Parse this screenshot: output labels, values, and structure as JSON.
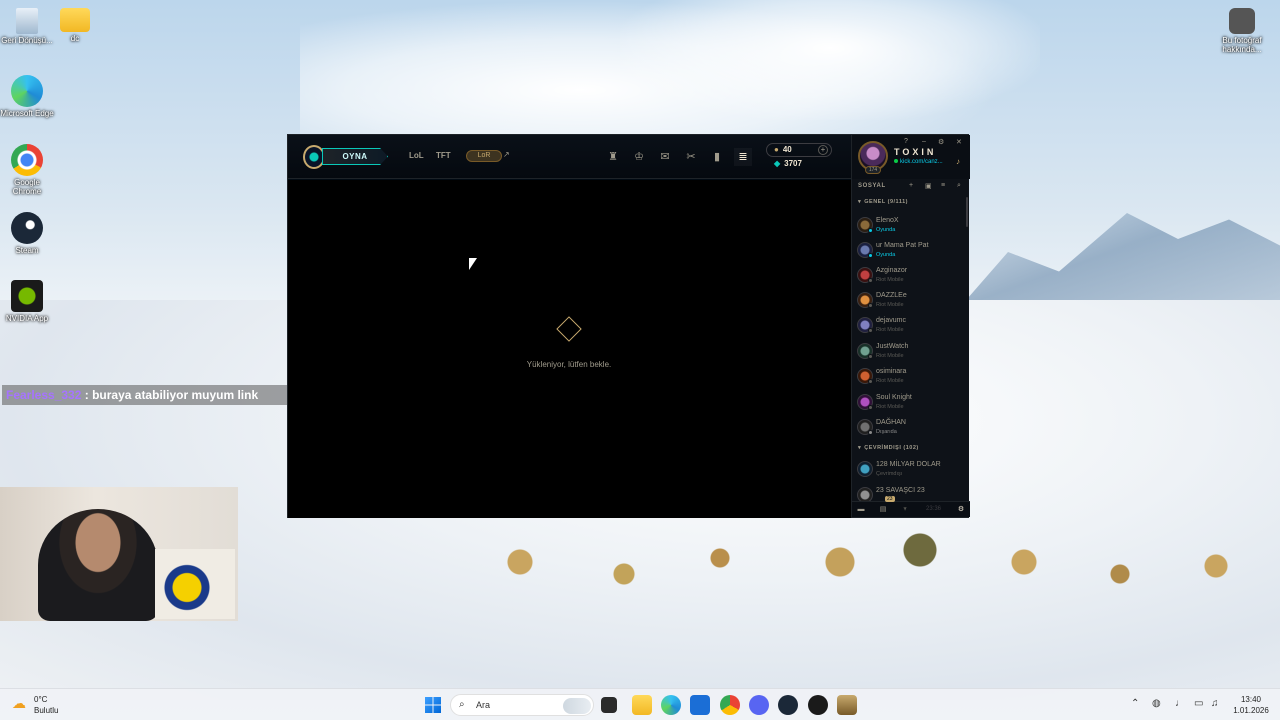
{
  "desktop": {
    "icons": [
      {
        "label": "Geri Dönüşü..."
      },
      {
        "label": "dc"
      },
      {
        "label": "Microsoft Edge"
      },
      {
        "label": "Google Chrome"
      },
      {
        "label": "Steam"
      },
      {
        "label": "NVIDIA App"
      },
      {
        "label": "Bu fotoğraf hakkında..."
      }
    ]
  },
  "chat_overlay": {
    "username": "Fearless_332",
    "message": ": buraya atabiliyor muyum link"
  },
  "client": {
    "play_label": "OYNA",
    "tabs": [
      "LoL",
      "TFT",
      "LoR"
    ],
    "blue_essence": "40",
    "riot_points": "3707",
    "loading_text": "Yükleniyor, lütfen bekle.",
    "nav_icons": [
      "trophy-icon",
      "champions-icon",
      "collection-icon",
      "crafting-icon",
      "loot-icon",
      "store-icon"
    ]
  },
  "social": {
    "summoner_name": "TOXIN",
    "status_message": "kick.com/canz...",
    "level": "174",
    "title": "SOSYAL",
    "groups": [
      {
        "label": "GENEL (9/111)"
      },
      {
        "label": "ÇEVRİMDIŞI (102)"
      }
    ],
    "friends": [
      {
        "name": "ElenoX",
        "status": "Oyunda",
        "type": "game"
      },
      {
        "name": "ur Mama Pat Pat",
        "status": "Oyunda",
        "type": "game"
      },
      {
        "name": "Azginazor",
        "status": "Riot Mobile",
        "type": "mobile"
      },
      {
        "name": "DAZZLEe",
        "status": "Riot Mobile",
        "type": "mobile"
      },
      {
        "name": "dejavumc",
        "status": "Riot Mobile",
        "type": "mobile"
      },
      {
        "name": "JustWatch",
        "status": "Riot Mobile",
        "type": "mobile"
      },
      {
        "name": "osiminara",
        "status": "Riot Mobile",
        "type": "mobile"
      },
      {
        "name": "Soul Knight",
        "status": "Riot Mobile",
        "type": "mobile"
      },
      {
        "name": "DAĞHAN",
        "status": "Dışarıda",
        "type": "away"
      },
      {
        "name": "128 MİLYAR DOLAR",
        "status": "Çevrimdışı",
        "type": "mobile"
      },
      {
        "name": "23 SAVAŞCI 23",
        "status": "",
        "type": "mobile"
      }
    ],
    "footer_badge": "23",
    "footer_time": "23:36"
  },
  "taskbar": {
    "temperature": "0°C",
    "condition": "Bulutlu",
    "search_placeholder": "Ara",
    "time": "13:40",
    "date": "1.01.2026"
  },
  "colors": {
    "gold": "#c8aa6e",
    "teal": "#0ac8b9",
    "client_bg": "#010a13",
    "in_game": "#0acbe6"
  }
}
